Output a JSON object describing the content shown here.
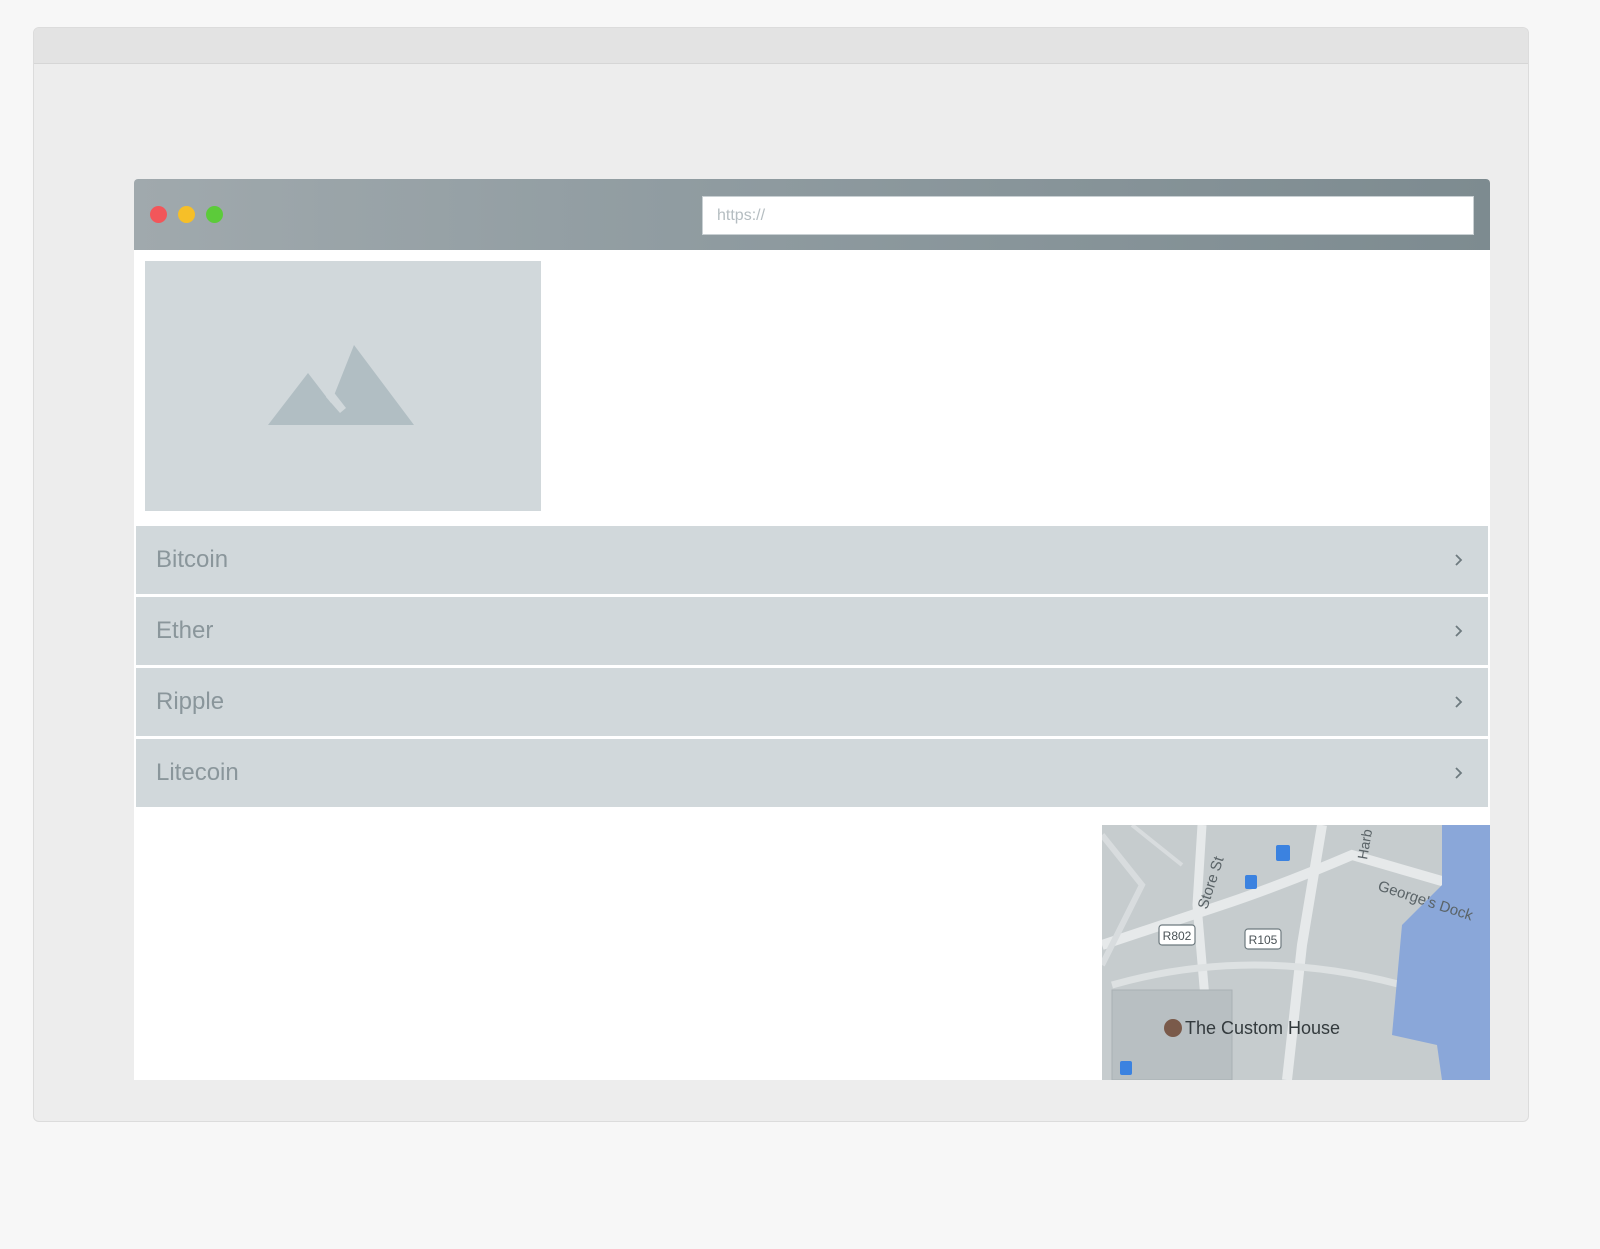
{
  "browser": {
    "url_placeholder": "https://",
    "window_controls": [
      "close",
      "minimize",
      "maximize"
    ]
  },
  "accordion": {
    "items": [
      {
        "label": "Bitcoin"
      },
      {
        "label": "Ether"
      },
      {
        "label": "Ripple"
      },
      {
        "label": "Litecoin"
      }
    ],
    "chevron_icon": "chevron-right-icon"
  },
  "image_placeholder": {
    "icon": "image-placeholder-icon"
  },
  "map": {
    "labels": {
      "street_1": "Store St",
      "street_2": "George's Dock",
      "street_3": "Harb",
      "road_1": "R802",
      "road_2": "R105",
      "landmark": "The Custom House"
    }
  },
  "colors": {
    "page_bg": "#f7f7f7",
    "frame_bg": "#ededed",
    "browser_bar": "#909ca1",
    "placeholder_bg": "#d1d8db",
    "accordion_text": "#8a969b",
    "close_dot": "#f2565a",
    "minimize_dot": "#f6bf28",
    "maximize_dot": "#5ccb3a",
    "water": "#8aa7d9"
  }
}
